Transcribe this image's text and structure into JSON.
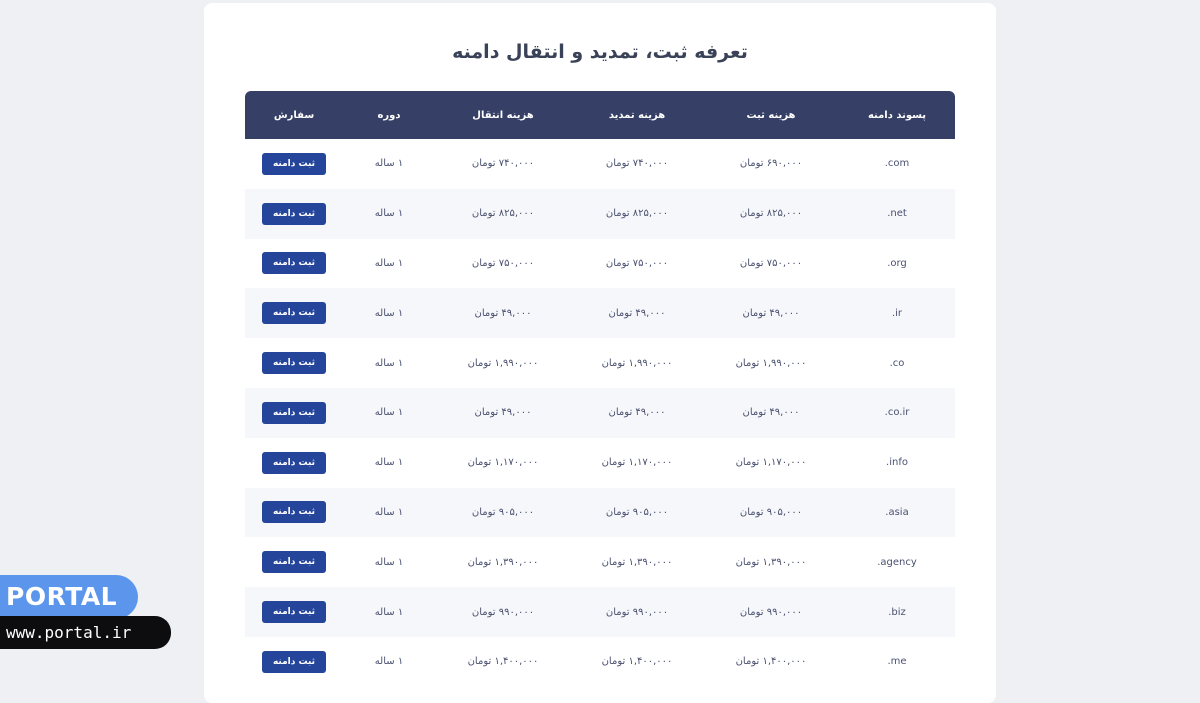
{
  "page": {
    "title": "تعرفه ثبت، تمدید و انتقال دامنه"
  },
  "table": {
    "headers": {
      "suffix": "پسوند دامنه",
      "register": "هزینه ثبت",
      "renew": "هزینه تمدید",
      "transfer": "هزینه انتقال",
      "period": "دوره",
      "order": "سفارش"
    },
    "rows": [
      {
        "suffix": ".com",
        "register": "۶۹۰,۰۰۰ تومان",
        "renew": "۷۴۰,۰۰۰ تومان",
        "transfer": "۷۴۰,۰۰۰ تومان",
        "period": "۱ ساله",
        "order": "ثبت دامنه"
      },
      {
        "suffix": ".net",
        "register": "۸۲۵,۰۰۰ تومان",
        "renew": "۸۲۵,۰۰۰ تومان",
        "transfer": "۸۲۵,۰۰۰ تومان",
        "period": "۱ ساله",
        "order": "ثبت دامنه"
      },
      {
        "suffix": ".org",
        "register": "۷۵۰,۰۰۰ تومان",
        "renew": "۷۵۰,۰۰۰ تومان",
        "transfer": "۷۵۰,۰۰۰ تومان",
        "period": "۱ ساله",
        "order": "ثبت دامنه"
      },
      {
        "suffix": ".ir",
        "register": "۴۹,۰۰۰ تومان",
        "renew": "۴۹,۰۰۰ تومان",
        "transfer": "۴۹,۰۰۰ تومان",
        "period": "۱ ساله",
        "order": "ثبت دامنه"
      },
      {
        "suffix": ".co",
        "register": "۱,۹۹۰,۰۰۰ تومان",
        "renew": "۱,۹۹۰,۰۰۰ تومان",
        "transfer": "۱,۹۹۰,۰۰۰ تومان",
        "period": "۱ ساله",
        "order": "ثبت دامنه"
      },
      {
        "suffix": ".co.ir",
        "register": "۴۹,۰۰۰ تومان",
        "renew": "۴۹,۰۰۰ تومان",
        "transfer": "۴۹,۰۰۰ تومان",
        "period": "۱ ساله",
        "order": "ثبت دامنه"
      },
      {
        "suffix": ".info",
        "register": "۱,۱۷۰,۰۰۰ تومان",
        "renew": "۱,۱۷۰,۰۰۰ تومان",
        "transfer": "۱,۱۷۰,۰۰۰ تومان",
        "period": "۱ ساله",
        "order": "ثبت دامنه"
      },
      {
        "suffix": ".asia",
        "register": "۹۰۵,۰۰۰ تومان",
        "renew": "۹۰۵,۰۰۰ تومان",
        "transfer": "۹۰۵,۰۰۰ تومان",
        "period": "۱ ساله",
        "order": "ثبت دامنه"
      },
      {
        "suffix": ".agency",
        "register": "۱,۳۹۰,۰۰۰ تومان",
        "renew": "۱,۳۹۰,۰۰۰ تومان",
        "transfer": "۱,۳۹۰,۰۰۰ تومان",
        "period": "۱ ساله",
        "order": "ثبت دامنه"
      },
      {
        "suffix": ".biz",
        "register": "۹۹۰,۰۰۰ تومان",
        "renew": "۹۹۰,۰۰۰ تومان",
        "transfer": "۹۹۰,۰۰۰ تومان",
        "period": "۱ ساله",
        "order": "ثبت دامنه"
      },
      {
        "suffix": ".me",
        "register": "۱,۴۰۰,۰۰۰ تومان",
        "renew": "۱,۴۰۰,۰۰۰ تومان",
        "transfer": "۱,۴۰۰,۰۰۰ تومان",
        "period": "۱ ساله",
        "order": "ثبت دامنه"
      }
    ]
  },
  "watermark": {
    "brand": "PORTAL",
    "url": "www.portal.ir"
  },
  "colors": {
    "header_bg": "#363f66",
    "button_bg": "#24459a",
    "brand_blue": "#5b95ec"
  }
}
